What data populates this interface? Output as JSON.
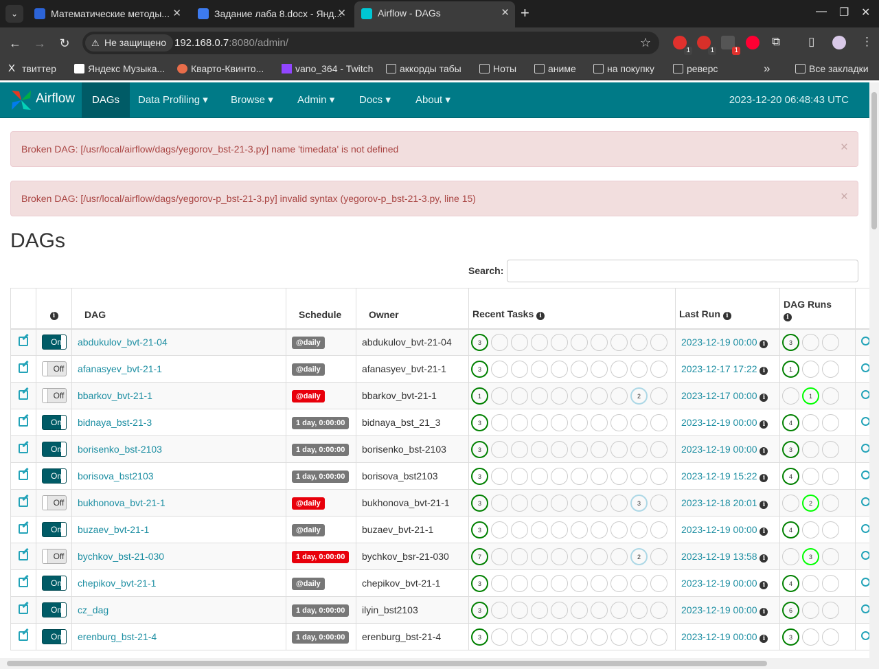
{
  "browser": {
    "tabs": [
      {
        "title": "Математические методы...",
        "active": false
      },
      {
        "title": "Задание лаба 8.docx - Янд...",
        "active": false
      },
      {
        "title": "Airflow - DAGs",
        "active": true
      }
    ],
    "security_label": "Не защищено",
    "url_host": "192.168.0.7",
    "url_rest": ":8080/admin/",
    "extension_badges": [
      "1",
      "1",
      "1"
    ],
    "bookmarks": [
      "твиттер",
      "Яндекс Музыка...",
      "Кварто-Квинто...",
      "vano_364 - Twitch",
      "аккорды табы",
      "Ноты",
      "аниме",
      "на покупку",
      "реверс"
    ],
    "bookmarks_more": "»",
    "all_bookmarks": "Все закладки"
  },
  "navbar": {
    "brand": "Airflow",
    "items": [
      "DAGs",
      "Data Profiling",
      "Browse",
      "Admin",
      "Docs",
      "About"
    ],
    "time": "2023-12-20 06:48:43 UTC"
  },
  "alerts": [
    "Broken DAG: [/usr/local/airflow/dags/yegorov_bst-21-3.py] name 'timedata' is not defined",
    "Broken DAG: [/usr/local/airflow/dags/yegorov-p_bst-21-3.py] invalid syntax (yegorov-p_bst-21-3.py, line 15)"
  ],
  "page_title": "DAGs",
  "search": {
    "label": "Search:",
    "value": ""
  },
  "columns": [
    "",
    "",
    "DAG",
    "Schedule",
    "Owner",
    "Recent Tasks",
    "Last Run",
    "DAG Runs"
  ],
  "rows": [
    {
      "on": true,
      "dag": "abdukulov_bvt-21-04",
      "schedule": "@daily",
      "sched_red": false,
      "owner": "abdukulov_bvt-21-04",
      "recent_first": "3",
      "recent_blue": "",
      "last_run": "2023-12-19 00:00",
      "runs": [
        "3",
        "",
        ""
      ],
      "runs_style": [
        "g",
        "",
        ""
      ]
    },
    {
      "on": false,
      "dag": "afanasyev_bvt-21-1",
      "schedule": "@daily",
      "sched_red": false,
      "owner": "afanasyev_bvt-21-1",
      "recent_first": "3",
      "recent_blue": "",
      "last_run": "2023-12-17 17:22",
      "runs": [
        "1",
        "",
        ""
      ],
      "runs_style": [
        "g",
        "",
        ""
      ]
    },
    {
      "on": false,
      "dag": "bbarkov_bvt-21-1",
      "schedule": "@daily",
      "sched_red": true,
      "owner": "bbarkov_bvt-21-1",
      "recent_first": "1",
      "recent_blue": "2",
      "last_run": "2023-12-17 00:00",
      "runs": [
        "",
        "1",
        ""
      ],
      "runs_style": [
        "",
        "lg",
        ""
      ]
    },
    {
      "on": true,
      "dag": "bidnaya_bst-21-3",
      "schedule": "1 day, 0:00:00",
      "sched_red": false,
      "owner": "bidnaya_bst_21_3",
      "recent_first": "3",
      "recent_blue": "",
      "last_run": "2023-12-19 00:00",
      "runs": [
        "4",
        "",
        ""
      ],
      "runs_style": [
        "g",
        "",
        ""
      ]
    },
    {
      "on": true,
      "dag": "borisenko_bst-2103",
      "schedule": "1 day, 0:00:00",
      "sched_red": false,
      "owner": "borisenko_bst-2103",
      "recent_first": "3",
      "recent_blue": "",
      "last_run": "2023-12-19 00:00",
      "runs": [
        "3",
        "",
        ""
      ],
      "runs_style": [
        "g",
        "",
        ""
      ]
    },
    {
      "on": true,
      "dag": "borisova_bst2103",
      "schedule": "1 day, 0:00:00",
      "sched_red": false,
      "owner": "borisova_bst2103",
      "recent_first": "3",
      "recent_blue": "",
      "last_run": "2023-12-19 15:22",
      "runs": [
        "4",
        "",
        ""
      ],
      "runs_style": [
        "g",
        "",
        ""
      ]
    },
    {
      "on": false,
      "dag": "bukhonova_bvt-21-1",
      "schedule": "@daily",
      "sched_red": true,
      "owner": "bukhonova_bvt-21-1",
      "recent_first": "3",
      "recent_blue": "3",
      "last_run": "2023-12-18 20:01",
      "runs": [
        "",
        "2",
        ""
      ],
      "runs_style": [
        "",
        "lg",
        ""
      ]
    },
    {
      "on": true,
      "dag": "buzaev_bvt-21-1",
      "schedule": "@daily",
      "sched_red": false,
      "owner": "buzaev_bvt-21-1",
      "recent_first": "3",
      "recent_blue": "",
      "last_run": "2023-12-19 00:00",
      "runs": [
        "4",
        "",
        ""
      ],
      "runs_style": [
        "g",
        "",
        ""
      ]
    },
    {
      "on": false,
      "dag": "bychkov_bst-21-030",
      "schedule": "1 day, 0:00:00",
      "sched_red": true,
      "owner": "bychkov_bsr-21-030",
      "recent_first": "7",
      "recent_blue": "2",
      "last_run": "2023-12-19 13:58",
      "runs": [
        "",
        "3",
        ""
      ],
      "runs_style": [
        "",
        "lg",
        ""
      ]
    },
    {
      "on": true,
      "dag": "chepikov_bvt-21-1",
      "schedule": "@daily",
      "sched_red": false,
      "owner": "chepikov_bvt-21-1",
      "recent_first": "3",
      "recent_blue": "",
      "last_run": "2023-12-19 00:00",
      "runs": [
        "4",
        "",
        ""
      ],
      "runs_style": [
        "g",
        "",
        ""
      ]
    },
    {
      "on": true,
      "dag": "cz_dag",
      "schedule": "1 day, 0:00:00",
      "sched_red": false,
      "owner": "ilyin_bst2103",
      "recent_first": "3",
      "recent_blue": "",
      "last_run": "2023-12-19 00:00",
      "runs": [
        "6",
        "",
        ""
      ],
      "runs_style": [
        "g",
        "",
        ""
      ]
    },
    {
      "on": true,
      "dag": "erenburg_bst-21-4",
      "schedule": "1 day, 0:00:00",
      "sched_red": false,
      "owner": "erenburg_bst-21-4",
      "recent_first": "3",
      "recent_blue": "",
      "last_run": "2023-12-19 00:00",
      "runs": [
        "3",
        "",
        ""
      ],
      "runs_style": [
        "g",
        "",
        ""
      ]
    }
  ],
  "toggle_labels": {
    "on": "On",
    "off": "Off"
  },
  "colors": {
    "navbar": "#007a87",
    "alert_bg": "#f2dede",
    "alert_text": "#a94442",
    "success": "#008000",
    "running": "#00ff00",
    "queued": "#add8e6",
    "label_red": "#e8000b"
  }
}
